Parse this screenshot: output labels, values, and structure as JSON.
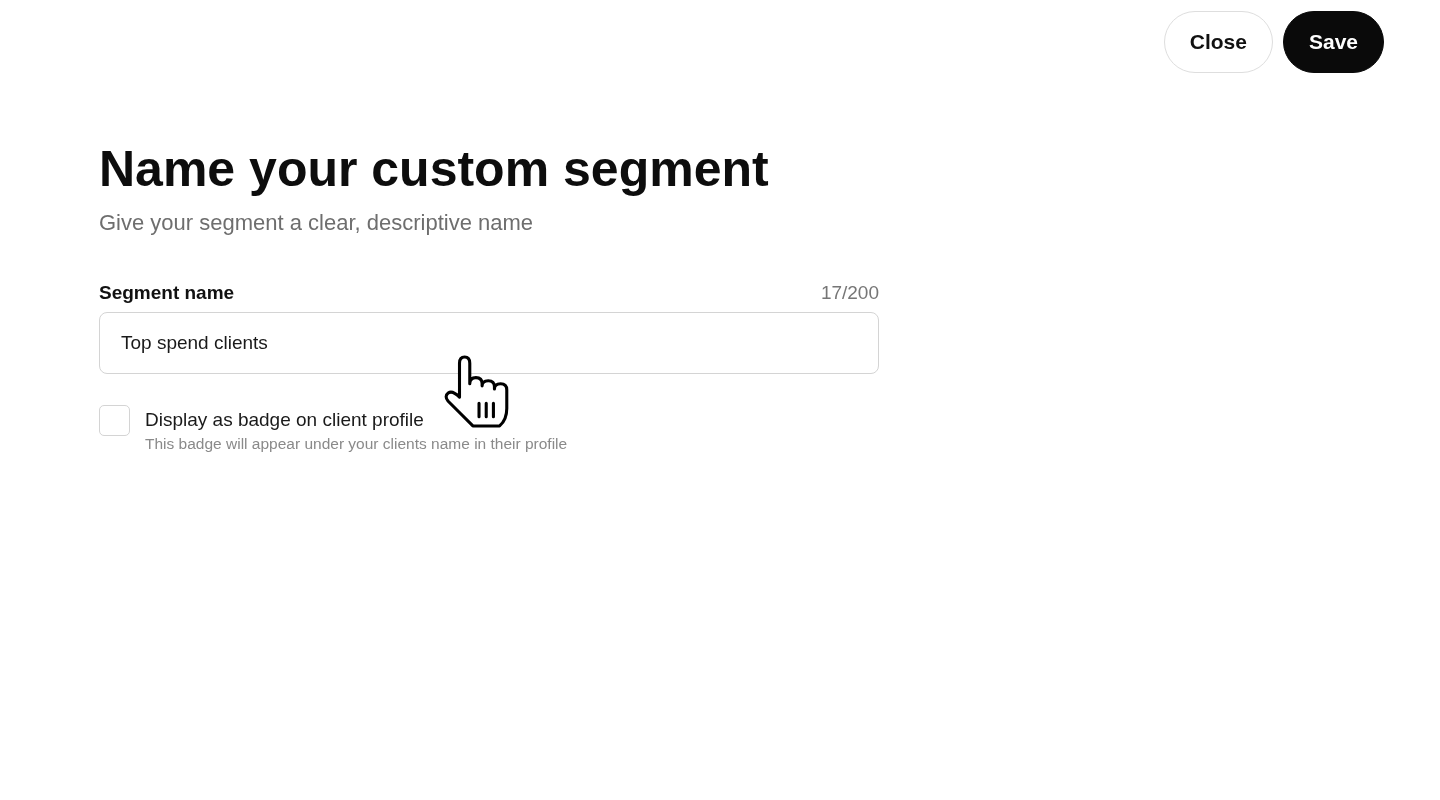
{
  "header": {
    "buttons": [
      {
        "label": "Close",
        "kind": "secondary"
      },
      {
        "label": "Save",
        "kind": "primary"
      }
    ]
  },
  "title": "Name your custom segment",
  "subtitle": "Give your segment a clear, descriptive name",
  "segment_name_field": {
    "label": "Segment name",
    "counter": "17/200",
    "value": "Top spend clients"
  },
  "badge_option": {
    "label": "Display as badge on client profile",
    "description": "This badge will appear under your clients name in their profile",
    "checked": false
  }
}
